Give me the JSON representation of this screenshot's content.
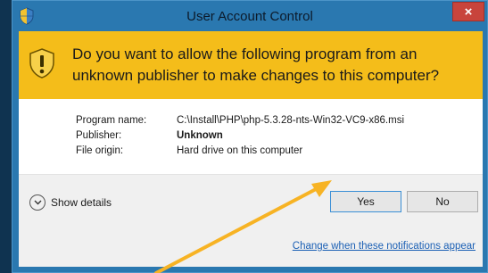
{
  "window": {
    "title": "User Account Control",
    "close_label": "×"
  },
  "banner": {
    "question": "Do you want to allow the following program from an unknown publisher to make changes to this computer?"
  },
  "details": {
    "program_name_label": "Program name:",
    "program_name_value": "C:\\Install\\PHP\\php-5.3.28-nts-Win32-VC9-x86.msi",
    "publisher_label": "Publisher:",
    "publisher_value": "Unknown",
    "file_origin_label": "File origin:",
    "file_origin_value": "Hard drive on this computer"
  },
  "footer": {
    "show_details_label": "Show details",
    "yes_label": "Yes",
    "no_label": "No",
    "change_link_label": "Change when these notifications appear"
  },
  "colors": {
    "banner": "#f4bd1a",
    "frame": "#2a78b0",
    "annotation_arrow": "#f7b324",
    "close_button": "#c8443c"
  },
  "icons": {
    "title_icon": "uac-shield-icon",
    "banner_icon": "warning-shield-icon",
    "show_details_icon": "chevron-down-circle-icon"
  }
}
